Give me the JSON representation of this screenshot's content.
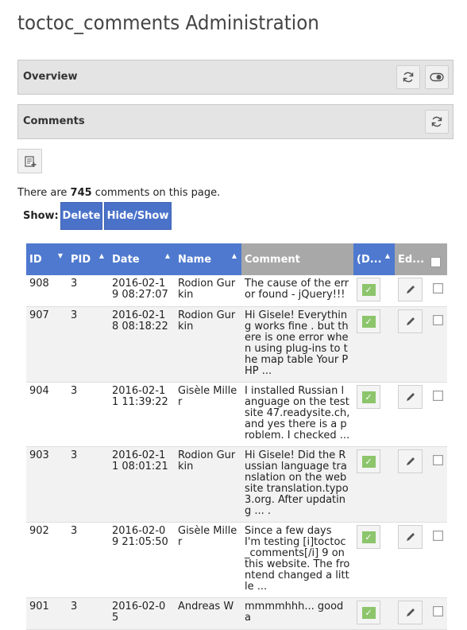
{
  "page": {
    "title": "toctoc_comments Administration"
  },
  "overview": {
    "title": "Overview"
  },
  "comments_panel": {
    "title": "Comments"
  },
  "summary": {
    "prefix": "There are ",
    "count": "745",
    "suffix": " comments on this page."
  },
  "show": {
    "label": "Show:",
    "delete_label": "Delete",
    "hideshow_label": "Hide/Show"
  },
  "table": {
    "headers": {
      "id": "ID",
      "pid": "PID",
      "date": "Date",
      "name": "Name",
      "comment": "Comment",
      "approved": "(D...",
      "edit": "Ed..."
    },
    "rows": [
      {
        "id": "908",
        "pid": "3",
        "date": "2016-02-19 08:27:07",
        "name": "Rodion Gurkin",
        "comment": "The cause of the error found - jQuery!!!"
      },
      {
        "id": "907",
        "pid": "3",
        "date": "2016-02-18 08:18:22",
        "name": "Rodion Gurkin",
        "comment": "Hi Gisele! Everything works fine . but there is one error when using plug-ins to the map table Your PHP ..."
      },
      {
        "id": "904",
        "pid": "3",
        "date": "2016-02-11 11:39:22",
        "name": "Gisèle Miller",
        "comment": "I installed Russian language on the test site 47.readysite.ch, and yes there is a problem. I checked ..."
      },
      {
        "id": "903",
        "pid": "3",
        "date": "2016-02-11 08:01:21",
        "name": "Rodion Gurkin",
        "comment": "Hi Gisele! Did the Russian language translation on the website translation.typo3.org. After updating ... ."
      },
      {
        "id": "902",
        "pid": "3",
        "date": "2016-02-09 21:05:50",
        "name": "Gisèle Miller",
        "comment": "Since a few days I'm testing [i]toctoc_comments[/i] 9 on this website. The frontend changed a little ..."
      },
      {
        "id": "901",
        "pid": "3",
        "date": "2016-02-05",
        "name": "Andreas W",
        "comment": "mmmmhhh... good a"
      }
    ]
  },
  "colors": {
    "header_blue": "#4e79cf",
    "button_blue": "#4a72c9",
    "approve_green": "#8cc56b"
  },
  "icons": [
    "refresh-icon",
    "toggle-icon",
    "new-record-icon",
    "pencil-icon",
    "check-icon"
  ]
}
